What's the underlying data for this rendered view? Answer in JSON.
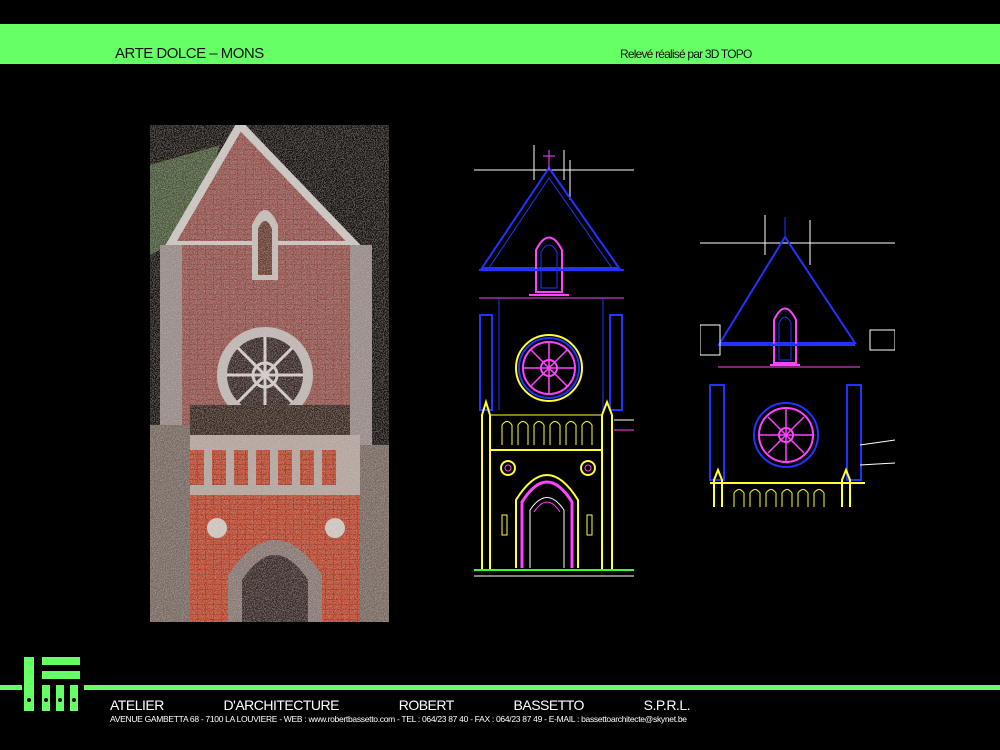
{
  "header": {
    "title": "ARTE DOLCE – MONS",
    "credit": "Relevé réalisé par 3D TOPO"
  },
  "colors": {
    "accent_green": "#66ff66",
    "cad_blue": "#2233ff",
    "cad_magenta": "#ff44ff",
    "cad_yellow": "#ffff33",
    "cad_white": "#ffffff"
  },
  "footer": {
    "name_words": [
      "ATELIER",
      "D'ARCHITECTURE",
      "ROBERT",
      "BASSETTO",
      "S.P.R.L."
    ],
    "address": "AVENUE GAMBETTA 68 - 7100 LA LOUVIERE - WEB : www.robertbassetto.com - TEL : 064/23 87 40 - FAX : 064/23 87 49 - E-MAIL : bassettoarchitecte@skynet.be"
  }
}
